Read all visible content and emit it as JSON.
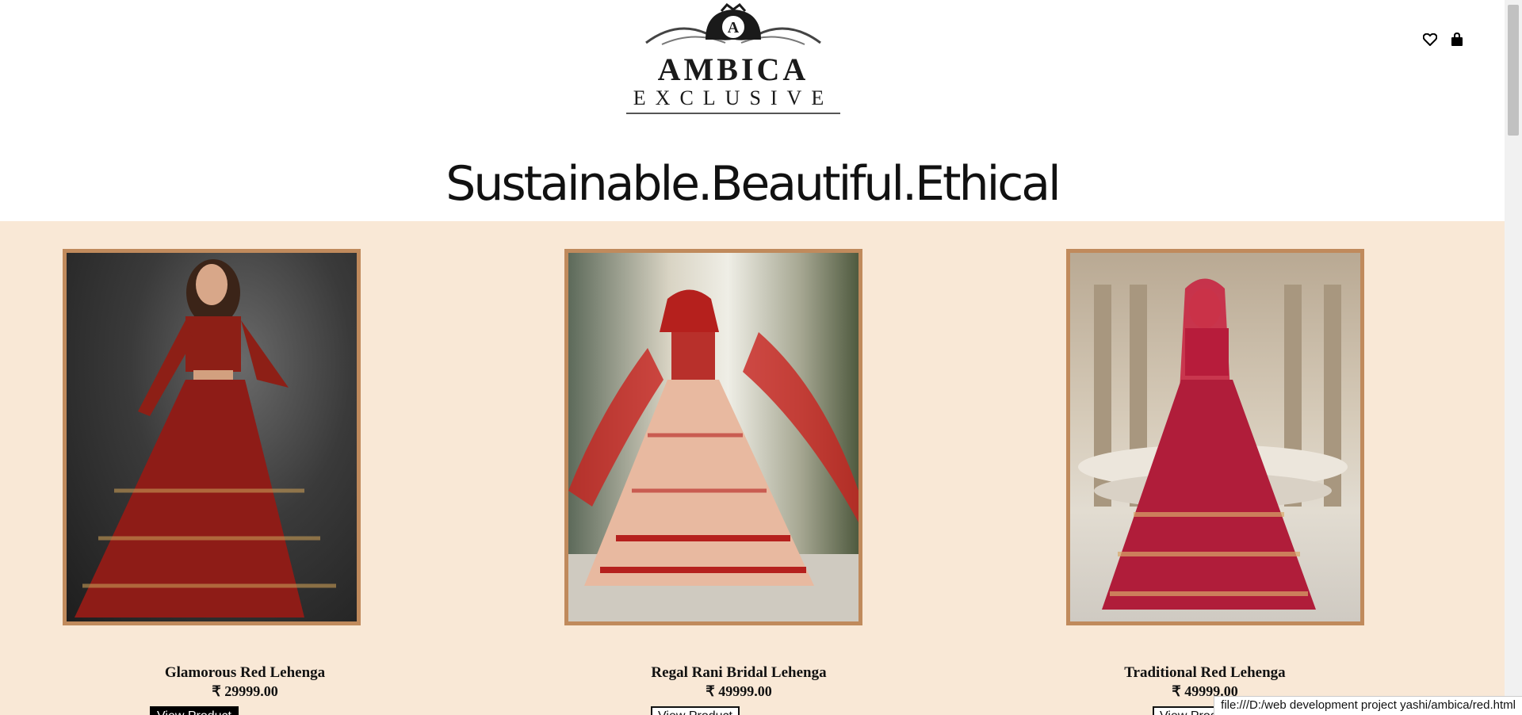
{
  "brand": {
    "name": "AMBICA",
    "subtitle": "EXCLUSIVE",
    "crest_letter": "A"
  },
  "header": {
    "icons": [
      "heart-icon",
      "shopping-bag-icon"
    ]
  },
  "tagline": "Sustainable.Beautiful.Ethical",
  "products": [
    {
      "name": "Glamorous Red Lehenga",
      "price": "₹ 29999.00",
      "button": "View Product"
    },
    {
      "name": "Regal Rani Bridal Lehenga",
      "price": "₹ 49999.00",
      "button": "View Product"
    },
    {
      "name": "Traditional Red Lehenga",
      "price": "₹ 49999.00",
      "button": "View Product"
    }
  ],
  "status_url": "file:///D:/web development project yashi/ambica/red.html",
  "colors": {
    "section_bg": "#f9e8d6",
    "frame": "#c08a5c",
    "button_active_bg": "#000000"
  }
}
